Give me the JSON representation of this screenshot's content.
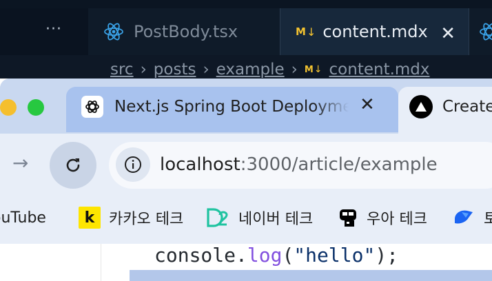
{
  "vscode": {
    "more_label": "···",
    "tabs": [
      {
        "label": "PostBody.tsx",
        "icon": "react-icon",
        "active": false
      },
      {
        "label": "content.mdx",
        "icon": "markdown-icon",
        "active": true,
        "close": "✕"
      }
    ],
    "breadcrumb": [
      "src",
      "posts",
      "example",
      "content.mdx"
    ],
    "mdx_badge": "M",
    "accent": "#f2c230"
  },
  "chrome": {
    "tabs": [
      {
        "title": "Next.js Spring Boot Deployme",
        "icon": "openai-icon",
        "close": "✕"
      },
      {
        "title": "Create",
        "icon": "vercel-icon"
      }
    ],
    "url_host": "localhost",
    "url_rest": ":3000/article/example",
    "bookmarks": [
      {
        "label": "ouTube",
        "icon": "youtube-icon"
      },
      {
        "label": "카카오 테크",
        "icon": "kakao-icon",
        "icon_text": "k"
      },
      {
        "label": "네이버 테크",
        "icon": "naver-d2-icon"
      },
      {
        "label": "우아 테크",
        "icon": "woowa-icon"
      },
      {
        "label": "토",
        "icon": "toss-icon"
      }
    ]
  },
  "editor": {
    "code_prefix": "console.",
    "code_fn": "log",
    "code_open": "(",
    "code_str": "\"hello\"",
    "code_close": ");"
  }
}
